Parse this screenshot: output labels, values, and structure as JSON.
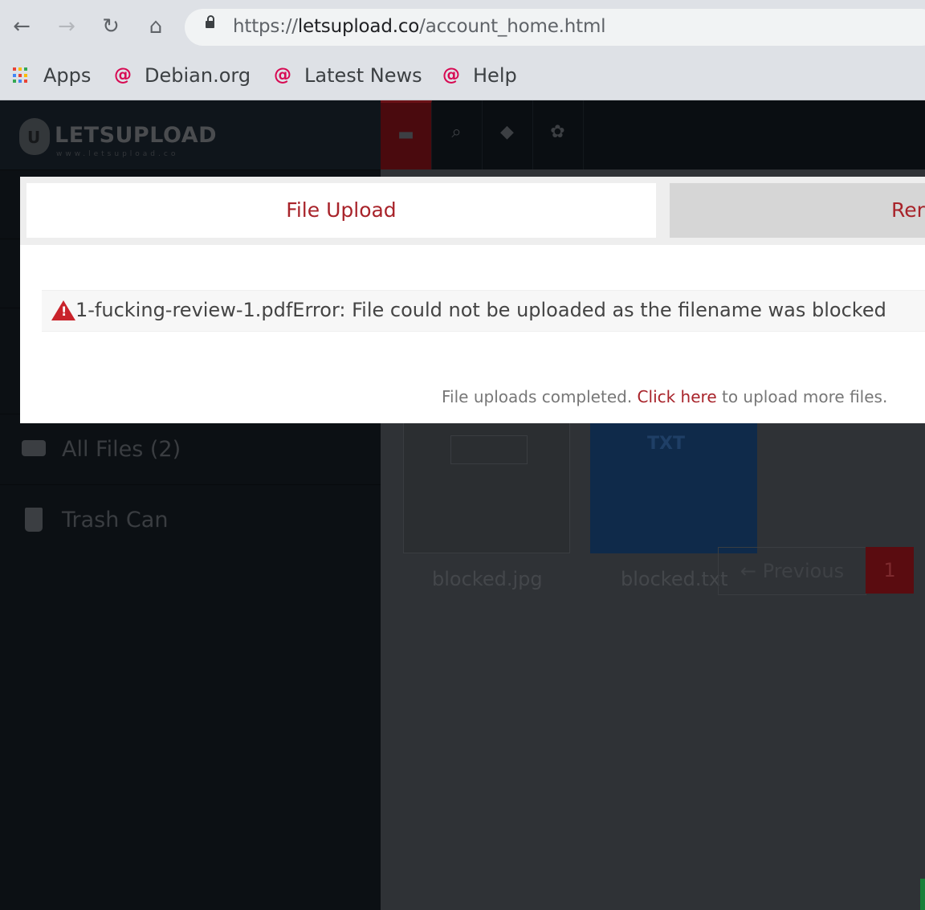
{
  "browser": {
    "url_scheme": "https://",
    "url_host": "letsupload.co",
    "url_path": "/account_home.html",
    "bookmarks": [
      {
        "label": "Apps",
        "icon": "apps-grid-icon"
      },
      {
        "label": "Debian.org",
        "icon": "debian-swirl-icon"
      },
      {
        "label": "Latest News",
        "icon": "debian-swirl-icon"
      },
      {
        "label": "Help",
        "icon": "debian-swirl-icon"
      }
    ]
  },
  "site": {
    "logo_text": "LETSUPLOAD",
    "logo_subtext": "www.letsupload.co"
  },
  "sidebar": {
    "items": [
      {
        "label": "All Files (2)",
        "icon": "drive-icon"
      },
      {
        "label": "Trash Can",
        "icon": "trash-icon"
      }
    ]
  },
  "topnav": {
    "icons": [
      "drive-icon",
      "search-icon",
      "tag-icon",
      "gear-icon"
    ]
  },
  "files": [
    {
      "name": "blocked.jpg",
      "thumb_label": ""
    },
    {
      "name": "blocked.txt",
      "thumb_label": "TXT"
    }
  ],
  "pager": {
    "prev_label": "← Previous",
    "current_page": "1"
  },
  "modal": {
    "tabs": [
      {
        "label": "File Upload"
      },
      {
        "label": "Rer"
      }
    ],
    "error_message": "1-fucking-review-1.pdfError: File could not be uploaded as the filename was blocked",
    "complete_prefix": "File uploads completed. ",
    "complete_link": "Click here",
    "complete_suffix": " to upload more files."
  },
  "colors": {
    "accent": "#a8232a",
    "error_icon": "#c9232b"
  }
}
